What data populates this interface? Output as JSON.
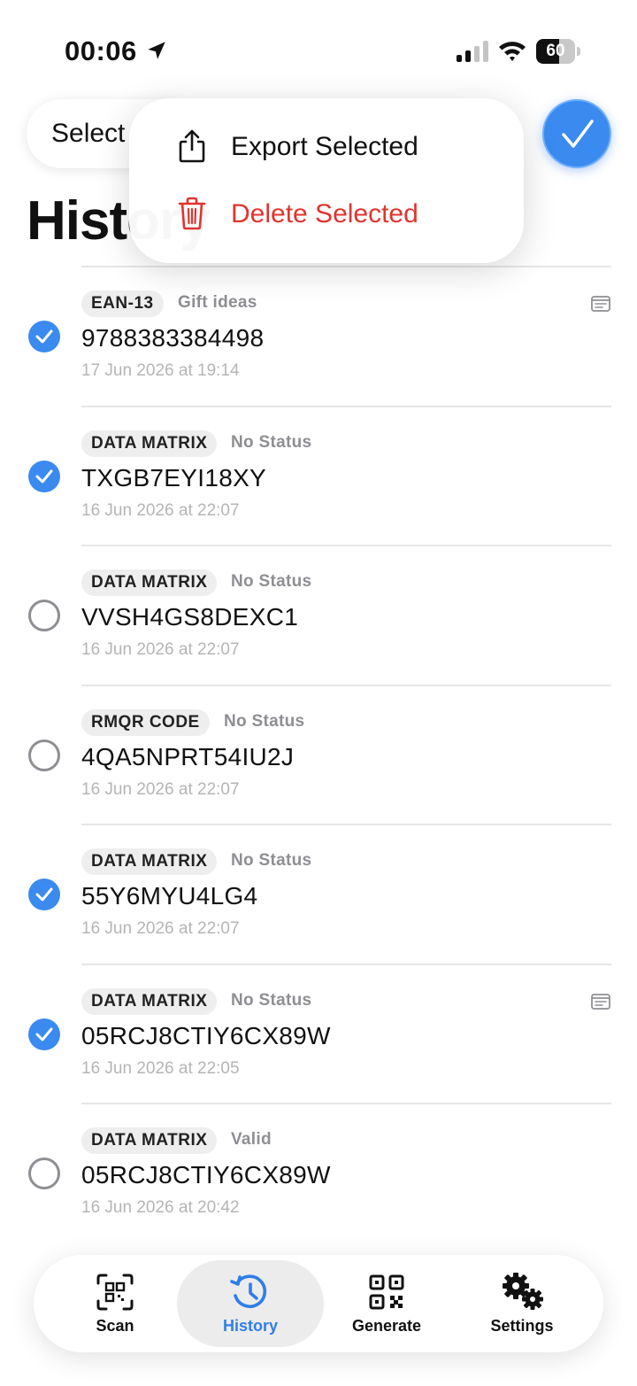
{
  "status_bar": {
    "time": "00:06",
    "battery": "60",
    "battery_level": 0.6
  },
  "top_bar": {
    "select_label": "Select",
    "title": "History"
  },
  "menu": {
    "export_label": "Export Selected",
    "delete_label": "Delete Selected",
    "export_icon": "share-icon",
    "delete_icon": "trash-icon",
    "delete_color": "#e0342f"
  },
  "colors": {
    "accent": "#3a8af0",
    "destructive": "#e0342f",
    "badge_bg": "#eeeeee",
    "secondary_text": "#8e8e93"
  },
  "items": [
    {
      "type": "EAN-13",
      "status": "Gift ideas",
      "value": "9788383384498",
      "date": "17 Jun 2026 at 19:14",
      "selected": true,
      "has_note": true
    },
    {
      "type": "DATA MATRIX",
      "status": "No Status",
      "value": "TXGB7EYI18XY",
      "date": "16 Jun 2026 at 22:07",
      "selected": true,
      "has_note": false
    },
    {
      "type": "DATA MATRIX",
      "status": "No Status",
      "value": "VVSH4GS8DEXC1",
      "date": "16 Jun 2026 at 22:07",
      "selected": false,
      "has_note": false
    },
    {
      "type": "RMQR CODE",
      "status": "No Status",
      "value": "4QA5NPRT54IU2J",
      "date": "16 Jun 2026 at 22:07",
      "selected": false,
      "has_note": false
    },
    {
      "type": "DATA MATRIX",
      "status": "No Status",
      "value": "55Y6MYU4LG4",
      "date": "16 Jun 2026 at 22:07",
      "selected": true,
      "has_note": false
    },
    {
      "type": "DATA MATRIX",
      "status": "No Status",
      "value": "05RCJ8CTIY6CX89W",
      "date": "16 Jun 2026 at 22:05",
      "selected": true,
      "has_note": true
    },
    {
      "type": "DATA MATRIX",
      "status": "Valid",
      "value": "05RCJ8CTIY6CX89W",
      "date": "16 Jun 2026 at 20:42",
      "selected": false,
      "has_note": false
    }
  ],
  "tabs": [
    {
      "label": "Scan",
      "icon": "scan-icon",
      "active": false
    },
    {
      "label": "History",
      "icon": "history-icon",
      "active": true
    },
    {
      "label": "Generate",
      "icon": "qr-code-icon",
      "active": false
    },
    {
      "label": "Settings",
      "icon": "gears-icon",
      "active": false
    }
  ]
}
